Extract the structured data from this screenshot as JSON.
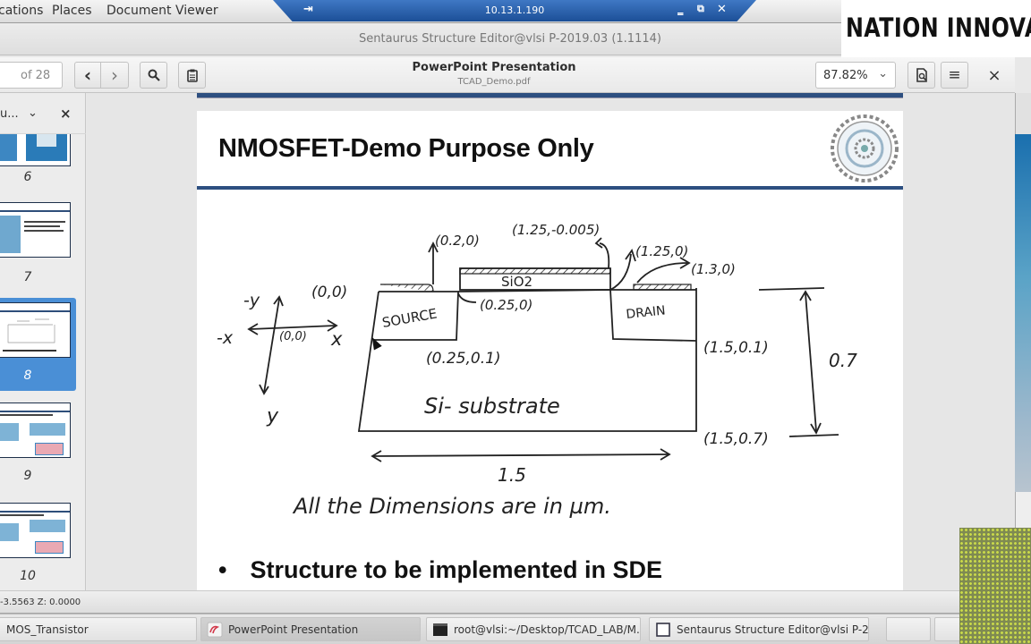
{
  "top_panel": {
    "menus": [
      "cations",
      "Places",
      "Document Viewer"
    ]
  },
  "vnc_bar": {
    "pin_icon": "pin-icon",
    "host": "10.13.1.190",
    "controls": [
      "minimize",
      "restore",
      "close"
    ],
    "minimize_glyph": "‗",
    "restore_glyph": "⧉",
    "close_glyph": "✕"
  },
  "window": {
    "title": "Sentaurus Structure Editor@vlsi P-2019.03 (1.1114)"
  },
  "brand": {
    "text": "NATION INNOVAT"
  },
  "toolbar": {
    "page_of": "of 28",
    "prev_glyph": "‹",
    "next_glyph": "›",
    "search_glyph": "⚲",
    "doc_title": "PowerPoint Presentation",
    "doc_file": "TCAD_Demo.pdf",
    "zoom_value": "87.82%",
    "zoom_chevron": "⌄",
    "menu_glyph": "≡",
    "close_glyph": "×"
  },
  "sidebar": {
    "header_label": "u...",
    "chevron": "⌄",
    "close": "×",
    "thumbnails": [
      {
        "page": "6",
        "selected": false
      },
      {
        "page": "7",
        "selected": false
      },
      {
        "page": "8",
        "selected": true
      },
      {
        "page": "9",
        "selected": false
      },
      {
        "page": "10",
        "selected": false
      }
    ]
  },
  "slide": {
    "title": "NMOSFET-Demo Purpose Only",
    "bullet": "Structure to be implemented in SDE",
    "sketch": {
      "axis_labels": {
        "neg_y": "-y",
        "neg_x": "-x",
        "x": "x",
        "y": "y",
        "origin": "(0,0)"
      },
      "regions": {
        "source": "SOURCE",
        "drain": "DRAIN",
        "oxide": "SiO2",
        "substrate": "Si- substrate"
      },
      "coordinates": {
        "origin_top_left": "(0,0)",
        "source_contact": "(0.2,0)",
        "oxide_top": "(1.25,-0.005)",
        "drain_contact_start": "(1.25,0)",
        "drain_contact_end": "(1.3,0)",
        "source_edge": "(0.25,0)",
        "source_bottom": "(0.25,0.1)",
        "drain_bottom": "(1.5,0.1)",
        "bottom_right": "(1.5,0.7)"
      },
      "width_label": "1.5",
      "height_label": "0.7",
      "note": "All the Dimensions are in µm."
    }
  },
  "status": {
    "coords": "-3.5563 Z: 0.0000"
  },
  "taskbar": {
    "items": [
      {
        "label": "MOS_Transistor",
        "active": false
      },
      {
        "label": "PowerPoint Presentation",
        "active": true
      },
      {
        "label": "root@vlsi:~/Desktop/TCAD_LAB/M...",
        "active": false
      },
      {
        "label": "Sentaurus Structure Editor@vlsi P-2...",
        "active": false
      }
    ]
  }
}
